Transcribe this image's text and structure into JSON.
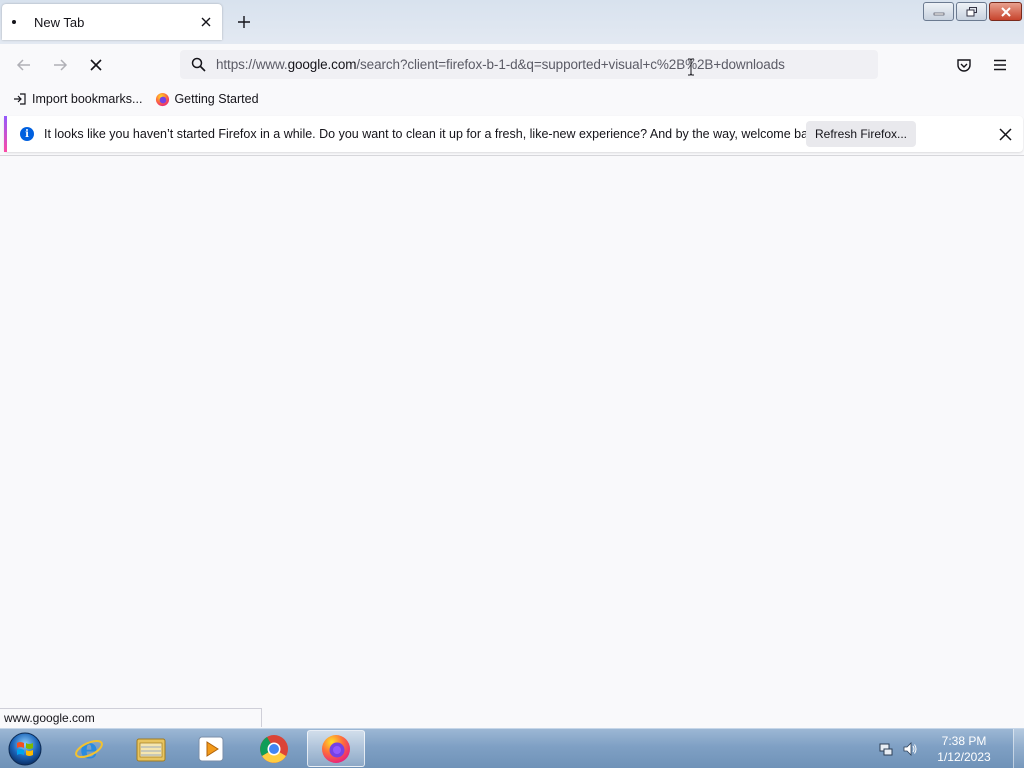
{
  "browser": {
    "tab": {
      "title": "New Tab"
    },
    "url": {
      "prefix": "https://www.",
      "domain": "google.com",
      "path": "/search?client=firefox-b-1-d&q=supported+visual+c%2B%2B+downloads"
    },
    "bookmarks": [
      {
        "label": "Import bookmarks...",
        "icon": "import-icon"
      },
      {
        "label": "Getting Started",
        "icon": "firefox-icon"
      }
    ],
    "notification": {
      "message": "It looks like you haven’t started Firefox in a while. Do you want to clean it up for a fresh, like-new experience? And by the way, welcome back!",
      "button_label": "Refresh Firefox..."
    },
    "status_text": "www.google.com"
  },
  "taskbar": {
    "apps": [
      {
        "name": "Internet Explorer",
        "icon": "ie-icon"
      },
      {
        "name": "Windows Explorer",
        "icon": "folder-icon"
      },
      {
        "name": "Windows Media Player",
        "icon": "media-player-icon"
      },
      {
        "name": "Google Chrome",
        "icon": "chrome-icon"
      },
      {
        "name": "Firefox",
        "icon": "firefox-icon",
        "active": true
      }
    ],
    "clock": {
      "time": "7:38 PM",
      "date": "1/12/2023"
    }
  },
  "colors": {
    "accent": "#0060df",
    "taskbar": "#7fa0c4",
    "close_button": "#c7442d"
  }
}
